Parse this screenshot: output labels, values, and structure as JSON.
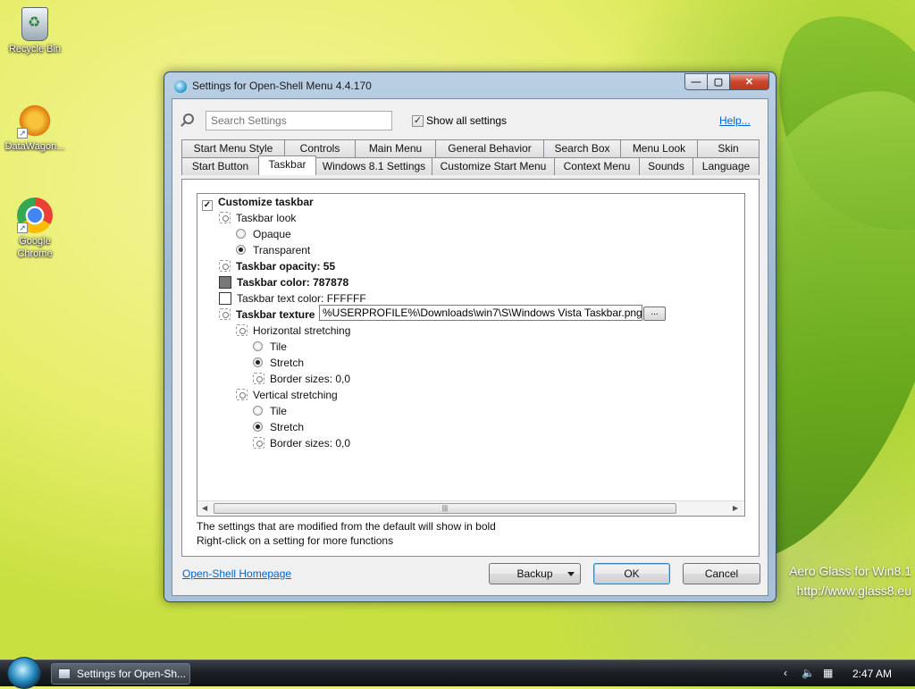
{
  "desktop": {
    "icons": [
      {
        "label": "Recycle Bin",
        "icon": "recycle-bin-icon"
      },
      {
        "label": "DataWagon...",
        "icon": "datawagon-icon"
      },
      {
        "label": "Google Chrome",
        "icon": "chrome-icon"
      }
    ],
    "watermark": {
      "line1": "Aero Glass for Win8.1",
      "line2": "http://www.glass8.eu"
    }
  },
  "window": {
    "title": "Settings for Open-Shell Menu 4.4.170",
    "search": {
      "placeholder": "Search Settings",
      "value": ""
    },
    "show_all": {
      "label": "Show all settings",
      "checked": true
    },
    "help_link": "Help...",
    "tabs_row1": [
      "Start Menu Style",
      "Controls",
      "Main Menu",
      "General Behavior",
      "Search Box",
      "Menu Look",
      "Skin"
    ],
    "tabs_row2": [
      "Start Button",
      "Taskbar",
      "Windows 8.1 Settings",
      "Customize Start Menu",
      "Context Menu",
      "Sounds",
      "Language"
    ],
    "active_tab": "Taskbar",
    "tree": {
      "customize_taskbar": "Customize taskbar",
      "taskbar_look": "Taskbar look",
      "opaque": "Opaque",
      "transparent": "Transparent",
      "opacity": "Taskbar opacity: 55",
      "color": "Taskbar color: 787878",
      "color_hex": "#787878",
      "text_color": "Taskbar text color: FFFFFF",
      "text_color_hex": "#FFFFFF",
      "texture": "Taskbar texture",
      "texture_value": "%USERPROFILE%\\Downloads\\win7\\S\\Windows Vista Taskbar.png",
      "browse": "...",
      "h_stretch": "Horizontal stretching",
      "tile": "Tile",
      "stretch": "Stretch",
      "border_sizes": "Border sizes: 0,0",
      "v_stretch": "Vertical stretching"
    },
    "info_line1": "The settings that are modified from the default will show in bold",
    "info_line2": "Right-click on a setting for more functions",
    "homepage_link": "Open-Shell Homepage",
    "buttons": {
      "backup": "Backup",
      "ok": "OK",
      "cancel": "Cancel"
    }
  },
  "taskbar": {
    "task_label": "Settings for Open-Sh...",
    "clock": "2:47 AM"
  }
}
